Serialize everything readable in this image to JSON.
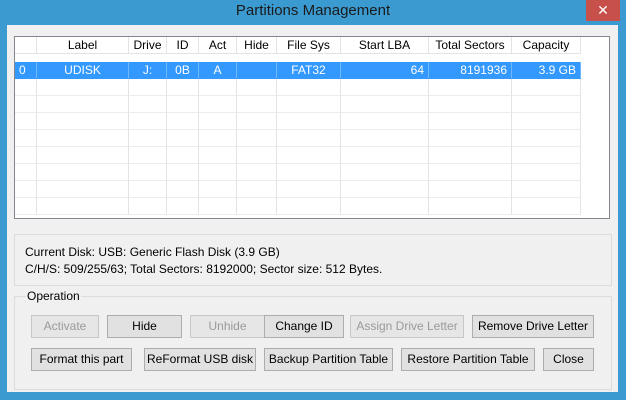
{
  "window": {
    "title": "Partitions Management",
    "close_glyph": "✕"
  },
  "table": {
    "columns": [
      "",
      "Label",
      "Drive",
      "ID",
      "Act",
      "Hide",
      "File Sys",
      "Start LBA",
      "Total Sectors",
      "Capacity"
    ],
    "rows": [
      [
        "0",
        "UDISK",
        "J:",
        "0B",
        "A",
        "",
        "FAT32",
        "64",
        "8191936",
        "3.9 GB"
      ]
    ],
    "selected_row": 0
  },
  "info": {
    "current_disk": "Current Disk:    USB: Generic Flash Disk (3.9 GB)",
    "chs": "C/H/S: 509/255/63; Total Sectors: 8192000; Sector size: 512 Bytes."
  },
  "operation": {
    "label": "Operation",
    "buttons": {
      "activate": "Activate",
      "hide": "Hide",
      "unhide": "Unhide",
      "change_id": "Change ID",
      "assign_drive_letter": "Assign Drive Letter",
      "remove_drive_letter": "Remove Drive Letter",
      "format_part": "Format this part",
      "reformat_usb": "ReFormat USB disk",
      "backup_table": "Backup Partition Table",
      "restore_table": "Restore Partition Table",
      "close": "Close"
    }
  }
}
